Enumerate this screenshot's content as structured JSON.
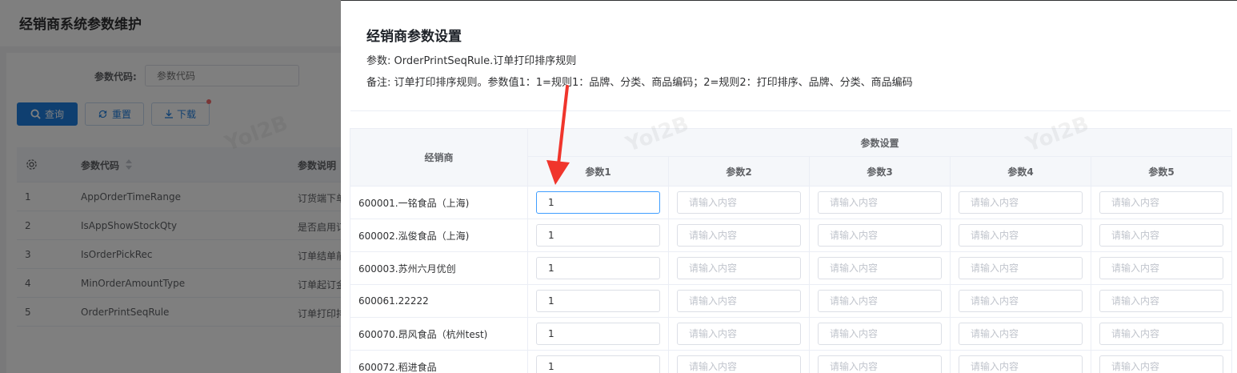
{
  "background": {
    "page_title": "经销商系统参数维护",
    "filter_label": "参数代码:",
    "filter_placeholder": "参数代码",
    "buttons": {
      "query": "查询",
      "reset": "重置",
      "download": "下载"
    },
    "table_headers": {
      "code": "参数代码",
      "desc": "参数说明"
    },
    "rows": [
      {
        "no": "1",
        "code": "AppOrderTimeRange",
        "desc": "订货端下单"
      },
      {
        "no": "2",
        "code": "IsAppShowStockQty",
        "desc": "是否启用订"
      },
      {
        "no": "3",
        "code": "IsOrderPickRec",
        "desc": "订单结单前"
      },
      {
        "no": "4",
        "code": "MinOrderAmountType",
        "desc": "订单起订金"
      },
      {
        "no": "5",
        "code": "OrderPrintSeqRule",
        "desc": "订单打印排"
      }
    ]
  },
  "drawer": {
    "title": "经销商参数设置",
    "param_line": "参数: OrderPrintSeqRule.订单打印排序规则",
    "note_line": "备注: 订单打印排序规则。参数值1：1=规则1：品牌、分类、商品编码；2=规则2：打印排序、品牌、分类、商品编码",
    "table": {
      "dealer_header": "经销商",
      "group_header": "参数设置",
      "param_headers": [
        "参数1",
        "参数2",
        "参数3",
        "参数4",
        "参数5"
      ],
      "placeholder": "请输入内容",
      "rows": [
        {
          "dealer": "600001.一铭食品（上海)",
          "p1": "1"
        },
        {
          "dealer": "600002.泓俊食品（上海)",
          "p1": "1"
        },
        {
          "dealer": "600003.苏州六月优创",
          "p1": "1"
        },
        {
          "dealer": "600061.22222",
          "p1": "1"
        },
        {
          "dealer": "600070.昂风食品（杭州test)",
          "p1": "1"
        },
        {
          "dealer": "600072.稻进食品",
          "p1": "1"
        }
      ]
    }
  },
  "watermark_text": "Yol2B",
  "colors": {
    "primary": "#1f7fe0",
    "focus_border": "#409eff",
    "annotation_arrow": "#f0352c"
  }
}
